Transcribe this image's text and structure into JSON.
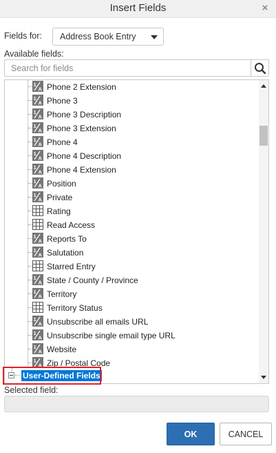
{
  "dialog": {
    "title": "Insert Fields",
    "close_glyph": "×"
  },
  "fields_for": {
    "label": "Fields for:",
    "value": "Address Book Entry"
  },
  "available": {
    "label": "Available fields:",
    "search_placeholder": "Search for fields"
  },
  "tree": {
    "items": [
      {
        "label": "Phone 2 Extension",
        "icon": "text-field-icon"
      },
      {
        "label": "Phone 3",
        "icon": "text-field-icon"
      },
      {
        "label": "Phone 3 Description",
        "icon": "text-field-icon"
      },
      {
        "label": "Phone 3 Extension",
        "icon": "text-field-icon"
      },
      {
        "label": "Phone 4",
        "icon": "text-field-icon"
      },
      {
        "label": "Phone 4 Description",
        "icon": "text-field-icon"
      },
      {
        "label": "Phone 4 Extension",
        "icon": "text-field-icon"
      },
      {
        "label": "Position",
        "icon": "text-field-icon"
      },
      {
        "label": "Private",
        "icon": "text-field-icon"
      },
      {
        "label": "Rating",
        "icon": "grid-field-icon"
      },
      {
        "label": "Read Access",
        "icon": "grid-field-icon"
      },
      {
        "label": "Reports To",
        "icon": "text-field-icon"
      },
      {
        "label": "Salutation",
        "icon": "text-field-icon"
      },
      {
        "label": "Starred Entry",
        "icon": "grid-field-icon"
      },
      {
        "label": "State / County / Province",
        "icon": "text-field-icon"
      },
      {
        "label": "Territory",
        "icon": "text-field-icon"
      },
      {
        "label": "Territory Status",
        "icon": "grid-field-icon"
      },
      {
        "label": "Unsubscribe all emails URL",
        "icon": "text-field-icon"
      },
      {
        "label": "Unsubscribe single email type URL",
        "icon": "text-field-icon"
      },
      {
        "label": "Website",
        "icon": "text-field-icon"
      },
      {
        "label": "Zip / Postal Code",
        "icon": "text-field-icon"
      }
    ],
    "group_label": "User-Defined Fields",
    "group_state": "expanded"
  },
  "selected": {
    "label": "Selected field:",
    "value": ""
  },
  "buttons": {
    "ok": "OK",
    "cancel": "CANCEL"
  },
  "colors": {
    "primary_button": "#2d6fb3",
    "selection": "#0078d7",
    "highlight_box": "#e32028",
    "icon_gray": "#767676"
  }
}
